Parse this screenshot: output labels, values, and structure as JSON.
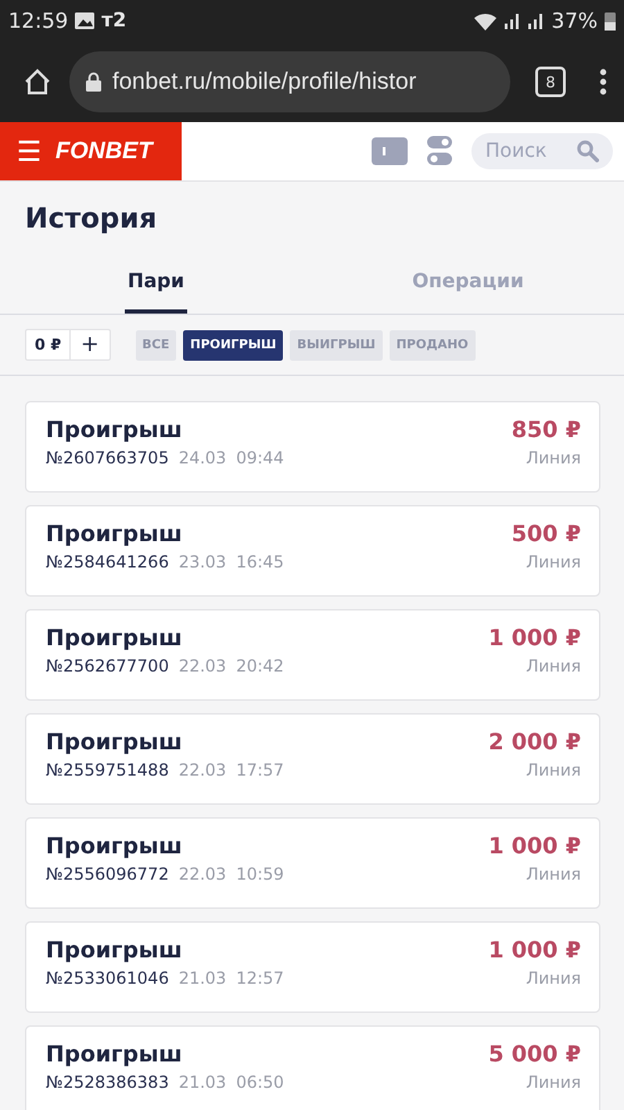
{
  "status_bar": {
    "time": "12:59",
    "carrier": "т2",
    "battery": "37%"
  },
  "browser": {
    "url": "fonbet.ru/mobile/profile/histor",
    "tab_count": "8"
  },
  "header": {
    "logo": "FONBET",
    "menu_glyph": "☰",
    "search": {
      "placeholder": "Поиск"
    }
  },
  "page": {
    "title": "История"
  },
  "tabs": [
    {
      "label": "Пари",
      "selected": true
    },
    {
      "label": "Операции",
      "selected": false
    }
  ],
  "amount_filter": {
    "value": "0 ₽",
    "add": "+"
  },
  "filters": [
    {
      "label": "ВСЕ",
      "selected": false
    },
    {
      "label": "ПРОИГРЫШ",
      "selected": true
    },
    {
      "label": "ВЫИГРЫШ",
      "selected": false
    },
    {
      "label": "ПРОДАНО",
      "selected": false
    }
  ],
  "bets": [
    {
      "result": "Проигрыш",
      "number": "№2607663705",
      "date": "24.03",
      "time": "09:44",
      "amount": "850 ₽",
      "type": "Линия"
    },
    {
      "result": "Проигрыш",
      "number": "№2584641266",
      "date": "23.03",
      "time": "16:45",
      "amount": "500 ₽",
      "type": "Линия"
    },
    {
      "result": "Проигрыш",
      "number": "№2562677700",
      "date": "22.03",
      "time": "20:42",
      "amount": "1 000 ₽",
      "type": "Линия"
    },
    {
      "result": "Проигрыш",
      "number": "№2559751488",
      "date": "22.03",
      "time": "17:57",
      "amount": "2 000 ₽",
      "type": "Линия"
    },
    {
      "result": "Проигрыш",
      "number": "№2556096772",
      "date": "22.03",
      "time": "10:59",
      "amount": "1 000 ₽",
      "type": "Линия"
    },
    {
      "result": "Проигрыш",
      "number": "№2533061046",
      "date": "21.03",
      "time": "12:57",
      "amount": "1 000 ₽",
      "type": "Линия"
    },
    {
      "result": "Проигрыш",
      "number": "№2528386383",
      "date": "21.03",
      "time": "06:50",
      "amount": "5 000 ₽",
      "type": "Линия"
    }
  ]
}
